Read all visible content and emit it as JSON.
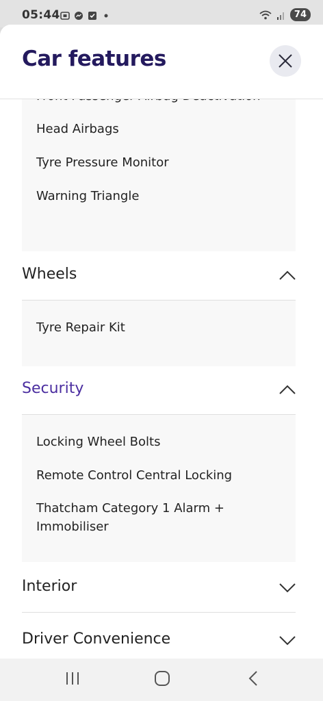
{
  "status_bar": {
    "time": "05:44",
    "battery": "74"
  },
  "header": {
    "title": "Car features"
  },
  "safety": {
    "items": [
      "Front Passenger Airbag Deactivation",
      "Head Airbags",
      "Tyre Pressure Monitor",
      "Warning Triangle"
    ]
  },
  "sections": {
    "wheels": {
      "title": "Wheels",
      "items": [
        "Tyre Repair Kit"
      ]
    },
    "security": {
      "title": "Security",
      "items": [
        "Locking Wheel Bolts",
        "Remote Control Central Locking",
        "Thatcham Category 1 Alarm + Immobiliser"
      ]
    },
    "interior": {
      "title": "Interior"
    },
    "driver_convenience": {
      "title": "Driver Convenience"
    }
  },
  "colors": {
    "title": "#241a5e",
    "active_section": "#4b2ea0",
    "panel_bg": "#f8f8f8"
  }
}
